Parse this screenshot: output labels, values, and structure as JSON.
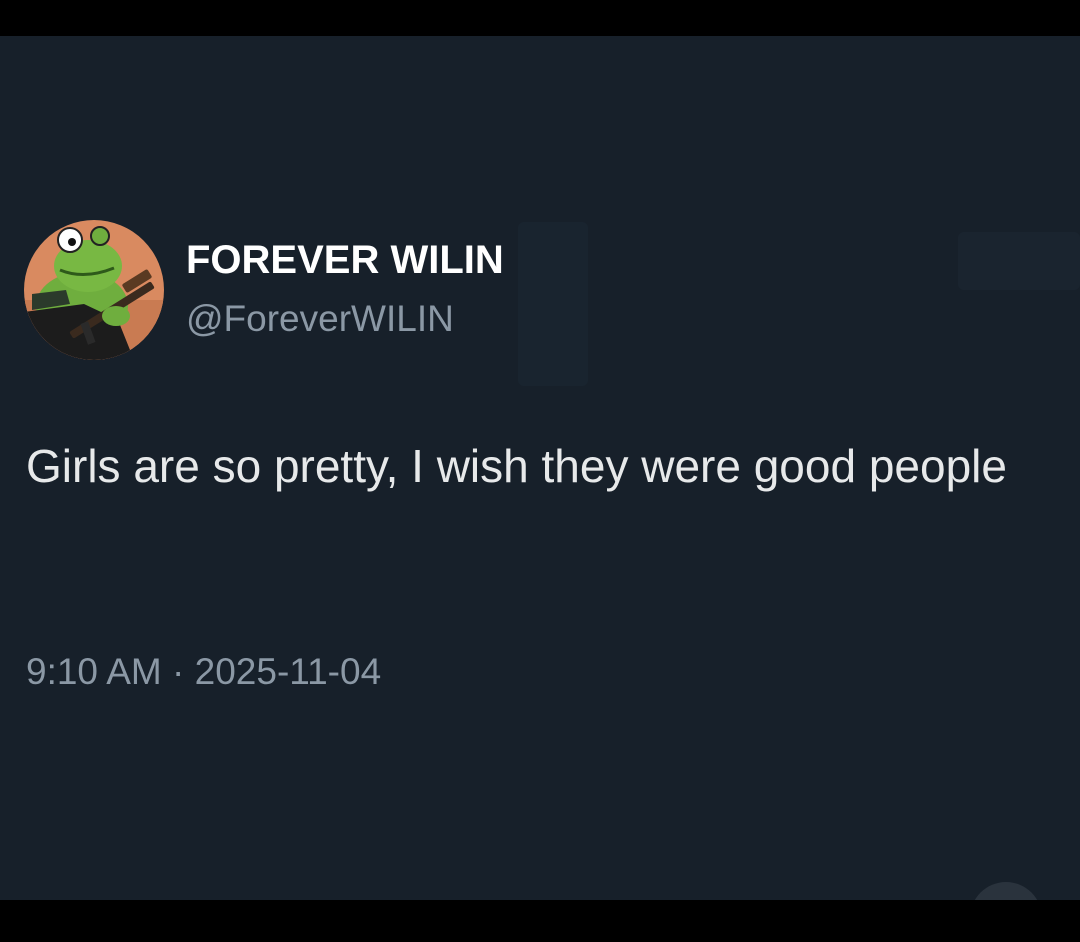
{
  "colors": {
    "background": "#17202a",
    "frame": "#000000",
    "name": "#ffffff",
    "text": "#e7e9ea",
    "secondary": "#8b98a5"
  },
  "author": {
    "display_name": "FOREVER WILIN",
    "handle": "@ForeverWILIN",
    "avatar_icon": "avatar-frog-icon"
  },
  "tweet": {
    "text": "Girls are so pretty, I wish they were good people",
    "timestamp": "9:10 AM · 2025-11-04"
  }
}
